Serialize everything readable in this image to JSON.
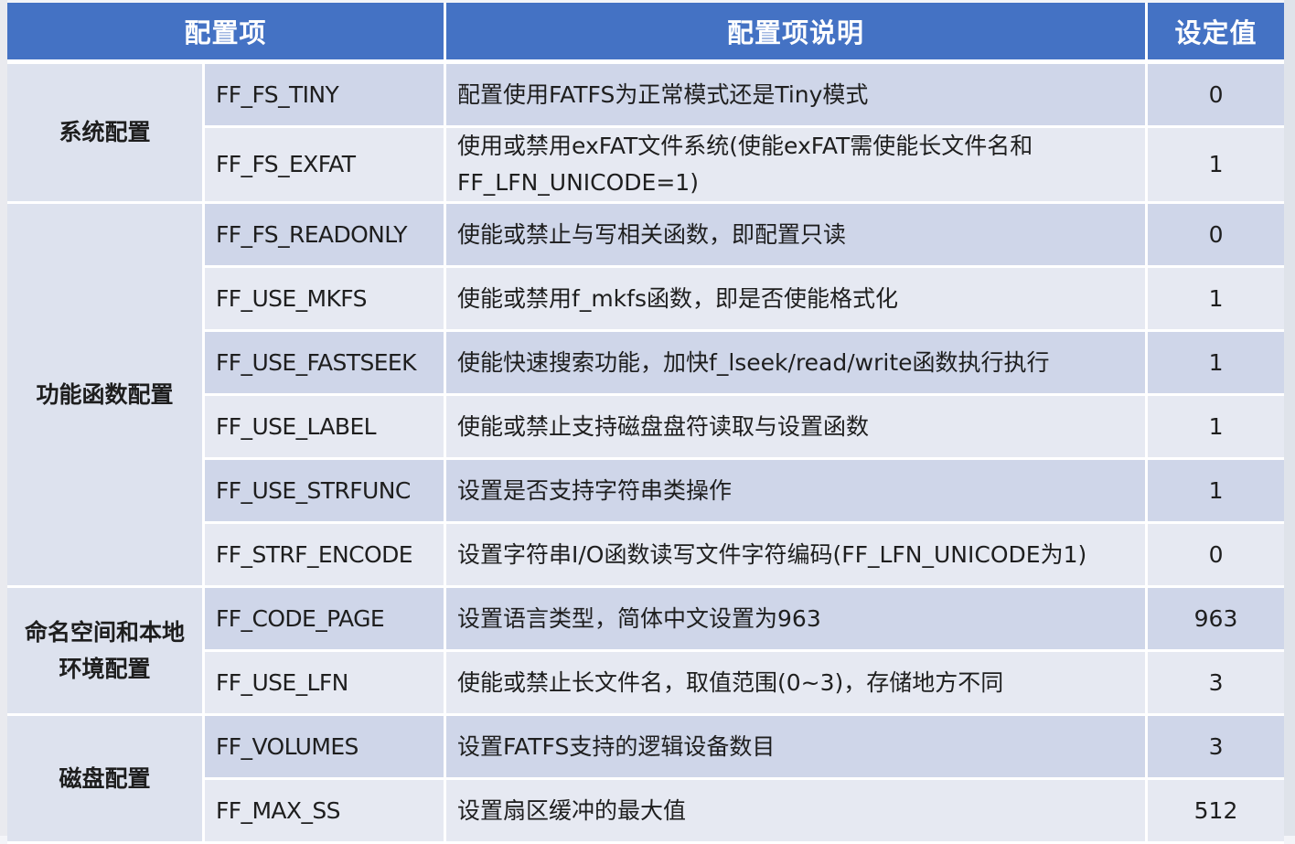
{
  "header": {
    "col_group": "配置项",
    "col_desc": "配置项说明",
    "col_value": "设定值"
  },
  "groups": [
    {
      "label": "系统配置"
    },
    {
      "label": "功能函数配置"
    },
    {
      "label": "命名空间和本地环境配置"
    },
    {
      "label": "磁盘配置"
    }
  ],
  "rows": [
    {
      "key": "FF_FS_TINY",
      "desc": "配置使用FATFS为正常模式还是Tiny模式",
      "value": "0"
    },
    {
      "key": "FF_FS_EXFAT",
      "desc": "使用或禁用exFAT文件系统(使能exFAT需使能长文件名和FF_LFN_UNICODE=1)",
      "value": "1"
    },
    {
      "key": "FF_FS_READONLY",
      "desc": "使能或禁止与写相关函数，即配置只读",
      "value": "0"
    },
    {
      "key": "FF_USE_MKFS",
      "desc": "使能或禁用f_mkfs函数，即是否使能格式化",
      "value": "1"
    },
    {
      "key": "FF_USE_FASTSEEK",
      "desc": "使能快速搜索功能，加快f_lseek/read/write函数执行执行",
      "value": "1"
    },
    {
      "key": "FF_USE_LABEL",
      "desc": "使能或禁止支持磁盘盘符读取与设置函数",
      "value": "1"
    },
    {
      "key": "FF_USE_STRFUNC",
      "desc": "设置是否支持字符串类操作",
      "value": "1"
    },
    {
      "key": "FF_STRF_ENCODE",
      "desc": "设置字符串I/O函数读写文件字符编码(FF_LFN_UNICODE为1)",
      "value": "0"
    },
    {
      "key": "FF_CODE_PAGE",
      "desc": "设置语言类型，简体中文设置为963",
      "value": "963"
    },
    {
      "key": "FF_USE_LFN",
      "desc": "使能或禁止长文件名，取值范围(0~3)，存储地方不同",
      "value": "3"
    },
    {
      "key": "FF_VOLUMES",
      "desc": "设置FATFS支持的逻辑设备数目",
      "value": "3"
    },
    {
      "key": "FF_MAX_SS",
      "desc": "设置扇区缓冲的最大值",
      "value": "512"
    }
  ]
}
